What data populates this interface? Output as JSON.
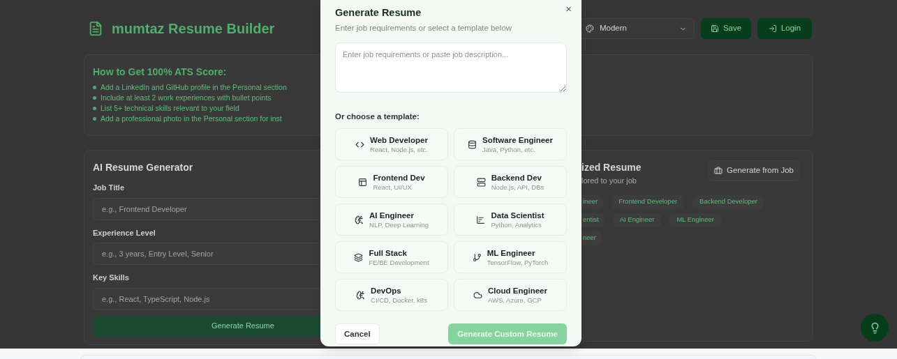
{
  "header": {
    "title": "mumtaz Resume Builder",
    "template_select": {
      "value": "Modern"
    },
    "buttons": [
      {
        "label": "Save"
      },
      {
        "label": "Login"
      }
    ]
  },
  "tips": {
    "title": "How to Get 100% ATS Score:",
    "items": [
      "Add a LinkedIn and GitHub profile in the Personal section",
      "Include at least 2 work experiences with bullet points",
      "List 5+ technical skills relevant to your field",
      "Add a professional photo in the Personal section for inst"
    ]
  },
  "generator": {
    "title": "AI Resume Generator",
    "fields": [
      {
        "label": "Job Title",
        "placeholder": "e.g., Frontend Developer"
      },
      {
        "label": "Experience Level",
        "placeholder": "e.g., 3 years, Entry Level, Senior"
      },
      {
        "label": "Key Skills",
        "placeholder": "e.g., React, TypeScript, Node.js"
      }
    ],
    "button": "Generate Resume"
  },
  "tailored": {
    "title": "ized Resume",
    "subtitle": "lored to your job",
    "button": "Generate from Job",
    "chip_rows": [
      [
        "ineer",
        "Frontend Developer",
        "Backend Developer"
      ],
      [
        "entist",
        "AI Engineer",
        "ML Engineer"
      ],
      [
        "neer"
      ]
    ]
  },
  "dialog": {
    "title": "Generate Resume",
    "subtitle": "Enter job requirements or select a template below",
    "close": "×",
    "textarea": {
      "placeholder": "Enter job requirements or paste job description..."
    },
    "section_label": "Or choose a template:",
    "templates": [
      {
        "title": "Web Developer",
        "subtitle": "React, Node.js, etc."
      },
      {
        "title": "Software Engineer",
        "subtitle": "Java, Python, etc."
      },
      {
        "title": "Frontend Dev",
        "subtitle": "React, UI/UX"
      },
      {
        "title": "Backend Dev",
        "subtitle": "Node.js, API, DBs"
      },
      {
        "title": "AI Engineer",
        "subtitle": "NLP, Deep Learning"
      },
      {
        "title": "Data Scientist",
        "subtitle": "Python, Analytics"
      },
      {
        "title": "Full Stack",
        "subtitle": "FE/BE Development"
      },
      {
        "title": "ML Engineer",
        "subtitle": "TensorFlow, PyTorch"
      },
      {
        "title": "DevOps",
        "subtitle": "CI/CD, Docker, k8s"
      },
      {
        "title": "Cloud Engineer",
        "subtitle": "AWS, Azure, GCP"
      }
    ],
    "cancel": "Cancel",
    "submit": {
      "label": "Generate Custom Resume",
      "disabled": true
    }
  }
}
